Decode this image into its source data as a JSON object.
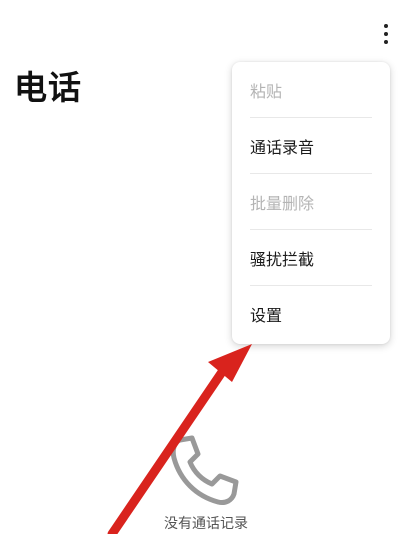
{
  "header": {
    "title": "电话",
    "more_icon": "more-vertical-icon"
  },
  "menu": {
    "items": [
      {
        "label": "粘贴",
        "enabled": false
      },
      {
        "label": "通话录音",
        "enabled": true
      },
      {
        "label": "批量删除",
        "enabled": false
      },
      {
        "label": "骚扰拦截",
        "enabled": true
      },
      {
        "label": "设置",
        "enabled": true
      }
    ]
  },
  "empty_state": {
    "icon": "phone-handset-icon",
    "text": "没有通话记录"
  },
  "colors": {
    "annotation_arrow": "#d9231d",
    "menu_text": "#1a1a1a",
    "menu_text_disabled": "#b4b4b4"
  }
}
